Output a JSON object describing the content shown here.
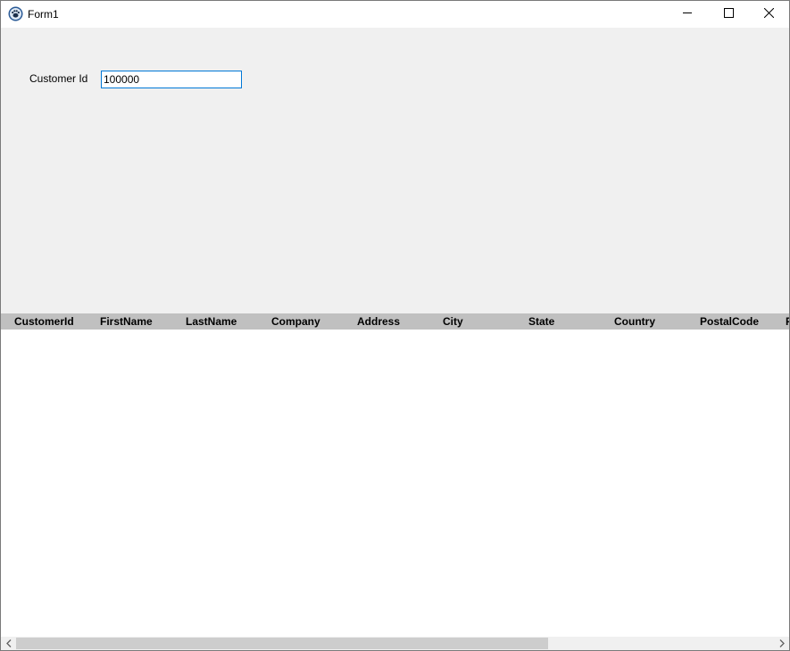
{
  "window": {
    "title": "Form1",
    "app_icon": "paw-icon",
    "controls": [
      "minimize-icon",
      "maximize-icon",
      "close-icon"
    ]
  },
  "form": {
    "customer_id_label": "Customer Id",
    "customer_id_value": "100000"
  },
  "grid": {
    "columns": [
      "CustomerId",
      "FirstName",
      "LastName",
      "Company",
      "Address",
      "City",
      "State",
      "Country",
      "PostalCode",
      "P"
    ],
    "rows": []
  },
  "scrollbar": {
    "left_arrow": "chevron-left-icon",
    "right_arrow": "chevron-right-icon"
  },
  "colors": {
    "form_background": "#f0f0f0",
    "header_background": "#c0c0c0",
    "input_border_focus": "#0078d7",
    "scroll_thumb": "#cdcdcd"
  }
}
